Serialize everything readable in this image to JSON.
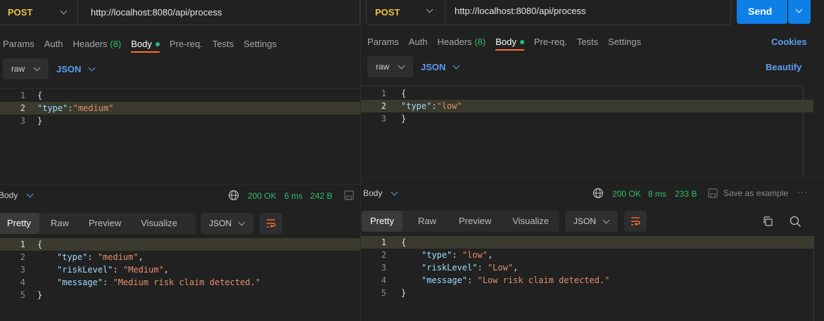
{
  "left": {
    "method": "POST",
    "url": "http://localhost:8080/api/process",
    "tabs": [
      {
        "label": "Params"
      },
      {
        "label": "Auth"
      },
      {
        "label": "Headers",
        "count": "(8)"
      },
      {
        "label": "Body"
      },
      {
        "label": "Pre-req."
      },
      {
        "label": "Tests"
      },
      {
        "label": "Settings"
      }
    ],
    "body_mode": "raw",
    "body_lang": "JSON",
    "request_lines": [
      "1",
      "2",
      "3"
    ],
    "request_key": "\"type\"",
    "request_val": "\"medium\"",
    "response_label": "Body",
    "status": "200 OK",
    "time": "6 ms",
    "size": "242 B",
    "view_tabs": [
      "Pretty",
      "Raw",
      "Preview",
      "Visualize"
    ],
    "format": "JSON",
    "response_lines": [
      "1",
      "2",
      "3",
      "4",
      "5"
    ],
    "resp_type_key": "\"type\"",
    "resp_type_val": "\"medium\"",
    "resp_risk_key": "\"riskLevel\"",
    "resp_risk_val": "\"Medium\"",
    "resp_msg_key": "\"message\"",
    "resp_msg_val": "\"Medium risk claim detected.\""
  },
  "right": {
    "method": "POST",
    "url": "http://localhost:8080/api/process",
    "send": "Send",
    "tabs": [
      {
        "label": "Params"
      },
      {
        "label": "Auth"
      },
      {
        "label": "Headers",
        "count": "(8)"
      },
      {
        "label": "Body"
      },
      {
        "label": "Pre-req."
      },
      {
        "label": "Tests"
      },
      {
        "label": "Settings"
      }
    ],
    "cookies": "Cookies",
    "beautify": "Beautify",
    "body_mode": "raw",
    "body_lang": "JSON",
    "request_lines": [
      "1",
      "2",
      "3"
    ],
    "request_key": "\"type\"",
    "request_val": "\"low\"",
    "response_label": "Body",
    "status": "200 OK",
    "time": "8 ms",
    "size": "233 B",
    "save_example": "Save as example",
    "more": "···",
    "view_tabs": [
      "Pretty",
      "Raw",
      "Preview",
      "Visualize"
    ],
    "format": "JSON",
    "response_lines": [
      "1",
      "2",
      "3",
      "4",
      "5"
    ],
    "resp_type_key": "\"type\"",
    "resp_type_val": "\"low\"",
    "resp_risk_key": "\"riskLevel\"",
    "resp_risk_val": "\"Low\"",
    "resp_msg_key": "\"message\"",
    "resp_msg_val": "\"Low risk claim detected.\""
  },
  "colors": {
    "accent": "#ff6c37",
    "success": "#2dbd6e",
    "link": "#5b9cf0",
    "method": "#f0c23a",
    "send": "#0f7fe8"
  },
  "icons": [
    "chevron-down-icon",
    "globe-icon",
    "save-icon",
    "wrap-lines-icon",
    "copy-icon",
    "search-icon",
    "dot-icon"
  ]
}
